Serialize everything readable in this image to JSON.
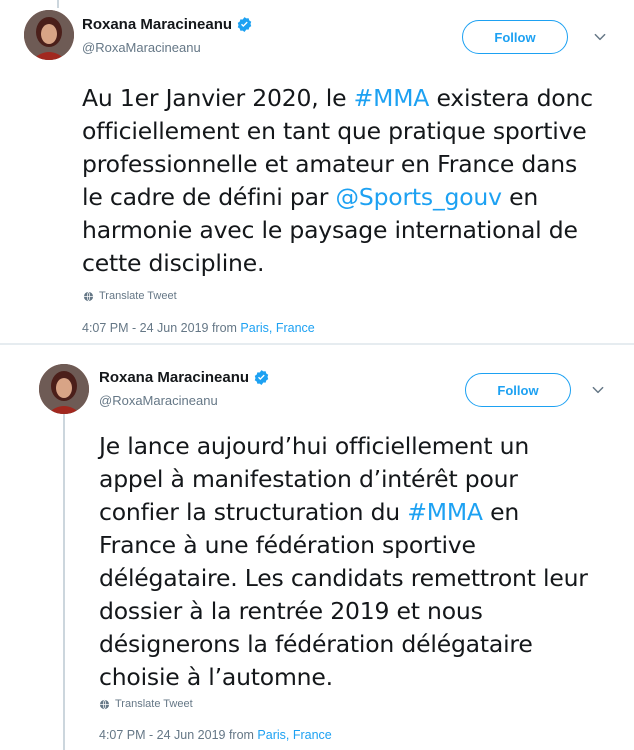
{
  "tweets": [
    {
      "author_name": "Roxana Maracineanu",
      "author_handle": "@RoxaMaracineanu",
      "follow_label": "Follow",
      "text_parts": [
        {
          "t": "Au 1er Janvier 2020, le ",
          "link": false
        },
        {
          "t": "#MMA",
          "link": true
        },
        {
          "t": " existera donc officiellement en tant que pratique sportive professionnelle et amateur en France dans le cadre de défini par ",
          "link": false
        },
        {
          "t": "@Sports_gouv",
          "link": true
        },
        {
          "t": " en harmonie avec le paysage international de cette discipline.",
          "link": false
        }
      ],
      "translate_label": "Translate Tweet",
      "timestamp": "4:07 PM - 24 Jun 2019 from ",
      "place_city": "Paris",
      "place_country": "France"
    },
    {
      "author_name": "Roxana Maracineanu",
      "author_handle": "@RoxaMaracineanu",
      "follow_label": "Follow",
      "text_parts": [
        {
          "t": "Je lance aujourd’hui officiellement un appel à manifestation d’intérêt pour confier la structuration du ",
          "link": false
        },
        {
          "t": "#MMA",
          "link": true
        },
        {
          "t": " en France à une fédération sportive délégataire. Les candidats remettront leur dossier à la rentrée 2019 et nous désignerons la fédération délégataire choisie à l’automne.",
          "link": false
        }
      ],
      "translate_label": "Translate Tweet",
      "timestamp": "4:07 PM - 24 Jun 2019 from ",
      "place_city": "Paris",
      "place_country": "France"
    }
  ],
  "colors": {
    "link": "#1da1f2",
    "text": "#14171a",
    "muted": "#657786",
    "verified": "#1da1f2"
  },
  "icons": {
    "verified": "verified-badge-icon",
    "chevron": "chevron-down-icon",
    "translate": "globe-icon"
  }
}
